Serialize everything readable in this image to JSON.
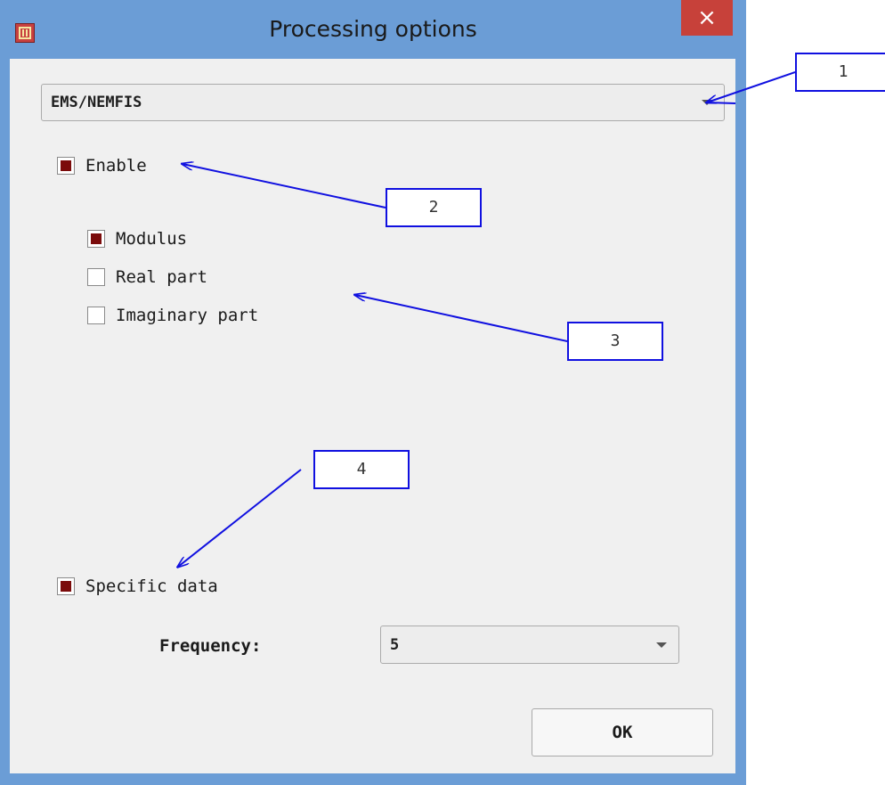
{
  "window": {
    "title": "Processing options",
    "close_glyph": "×",
    "app_icon": "app-icon"
  },
  "mode_select": {
    "value": "EMS/NEMFIS"
  },
  "enable": {
    "label": "Enable",
    "checked": true
  },
  "components": [
    {
      "label": "Modulus",
      "checked": true
    },
    {
      "label": "Real part",
      "checked": false
    },
    {
      "label": "Imaginary part",
      "checked": false
    }
  ],
  "specific_data": {
    "label": "Specific data",
    "checked": true
  },
  "frequency": {
    "label": "Frequency:",
    "value": "5"
  },
  "ok_label": "OK",
  "callouts": [
    "1",
    "2",
    "3",
    "4"
  ],
  "colors": {
    "titlebar": "#6b9dd6",
    "check_fill": "#7b0b0b",
    "callout_border": "#1010e0",
    "close": "#c7413a"
  }
}
